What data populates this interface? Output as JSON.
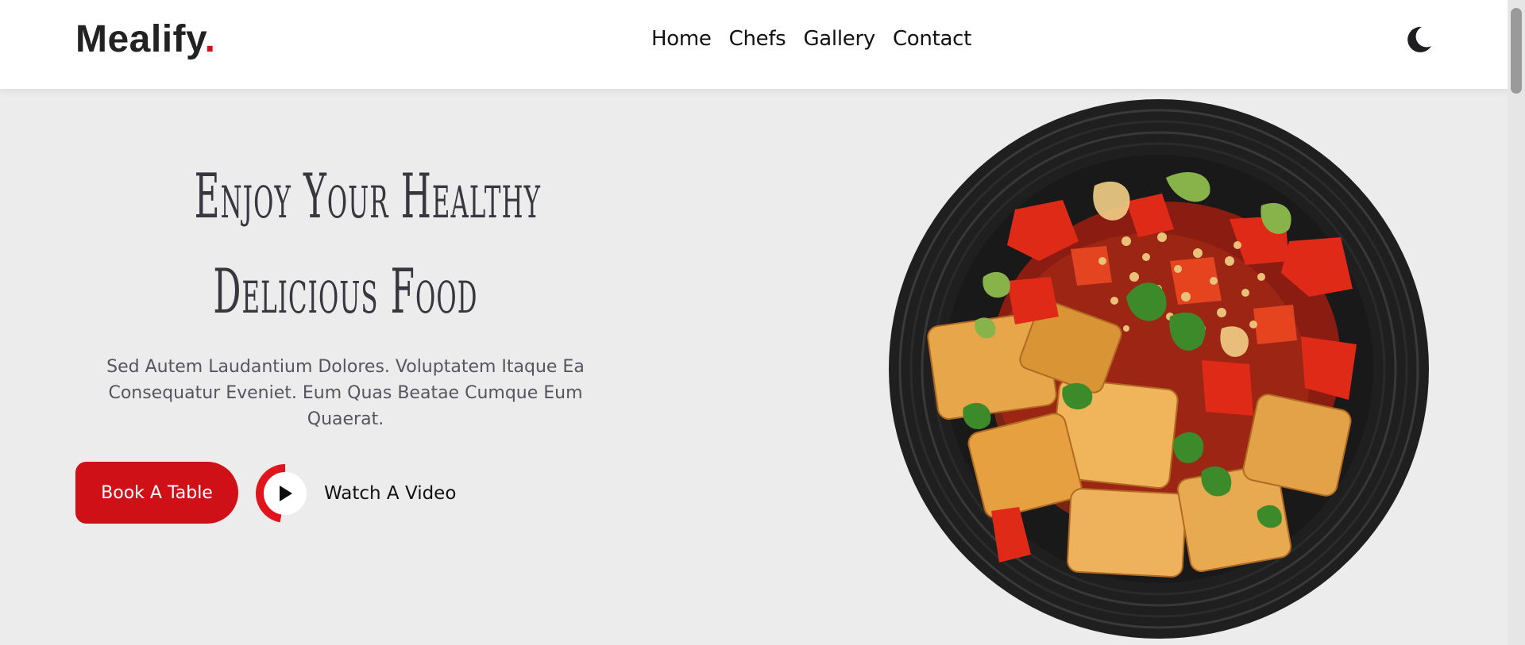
{
  "header": {
    "brand": "Mealify",
    "brand_dot": ".",
    "nav": [
      "Home",
      "Chefs",
      "Gallery",
      "Contact"
    ],
    "theme_icon": "moon-icon"
  },
  "hero": {
    "title_lines": [
      "Enjoy Your Healthy",
      "Delicious Food"
    ],
    "subtitle": "Sed Autem Laudantium Dolores. Voluptatem Itaque Ea Consequatur Eveniet. Eum Quas Beatae Cumque Eum Quaerat.",
    "book_button": "Book A Table",
    "video_label": "Watch A Video",
    "video_icon": "play-icon",
    "image_alt": "food-dish"
  },
  "colors": {
    "accent": "#cf1117",
    "background": "#ececec",
    "header_bg": "#ffffff",
    "text_dark": "#37373f"
  }
}
